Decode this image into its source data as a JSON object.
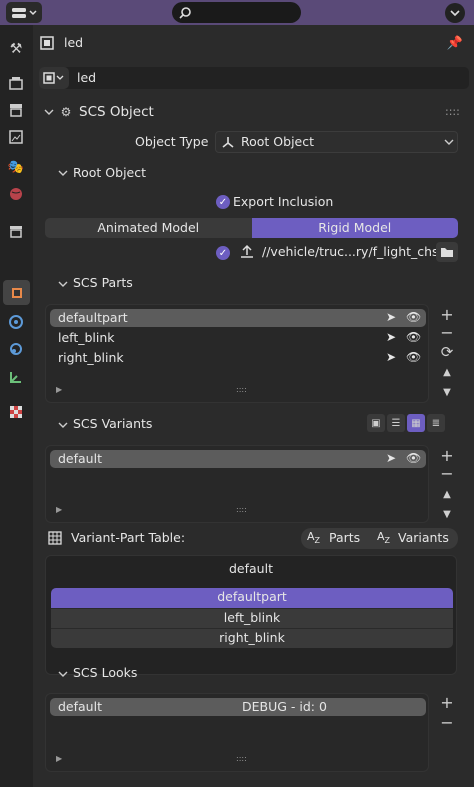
{
  "header": {
    "object_name": "led",
    "data_name": "led"
  },
  "scs_object": {
    "title": "SCS Object",
    "object_type_label": "Object Type",
    "object_type_value": "Root Object",
    "root_object_title": "Root Object",
    "export_inclusion": "Export Inclusion",
    "tabs": [
      "Animated Model",
      "Rigid Model"
    ],
    "path": "//vehicle/truc...ry/f_light_chs"
  },
  "scs_parts": {
    "title": "SCS Parts",
    "items": [
      "defaultpart",
      "left_blink",
      "right_blink"
    ]
  },
  "scs_variants": {
    "title": "SCS Variants",
    "items": [
      "default"
    ]
  },
  "variant_part_table": {
    "title": "Variant-Part Table:",
    "sort_parts": "Parts",
    "sort_variants": "Variants",
    "variant": "default",
    "parts": [
      "defaultpart",
      "left_blink",
      "right_blink"
    ]
  },
  "scs_looks": {
    "title": "SCS Looks",
    "items": [
      {
        "name": "default",
        "info": "DEBUG - id: 0"
      }
    ]
  },
  "colors": {
    "accent": "#6d5ec1",
    "topbar": "#5a4a78"
  }
}
